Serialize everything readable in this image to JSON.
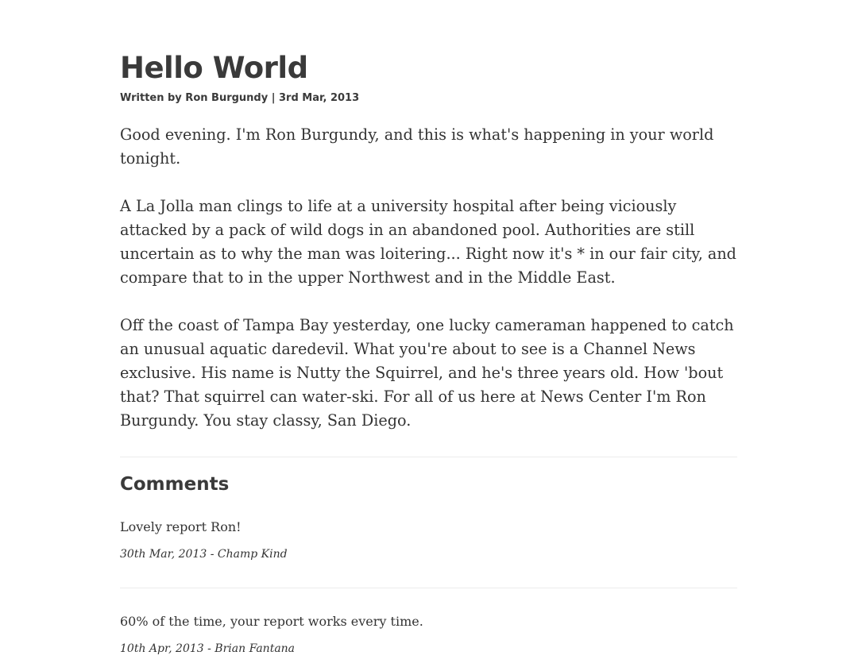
{
  "article": {
    "title": "Hello World",
    "byline": "Written by Ron Burgundy | 3rd Mar, 2013",
    "paragraphs": [
      "Good evening. I'm Ron Burgundy, and this is what's happening in your world tonight.",
      "A La Jolla man clings to life at a university hospital after being viciously attacked by a pack of wild dogs in an abandoned pool. Authorities are still uncertain as to why the man was loitering... Right now it's * in our fair city, and compare that to in the upper Northwest and in the Middle East.",
      "Off the coast of Tampa Bay yesterday, one lucky cameraman happened to catch an unusual aquatic daredevil. What you're about to see is a Channel News exclusive. His name is Nutty the Squirrel, and he's three years old. How 'bout that? That squirrel can water-ski. For all of us here at News Center I'm Ron Burgundy. You stay classy, San Diego."
    ]
  },
  "comments": {
    "heading": "Comments",
    "items": [
      {
        "text": "Lovely report Ron!",
        "meta": "30th Mar, 2013 - Champ Kind"
      },
      {
        "text": "60% of the time, your report works every time.",
        "meta": "10th Apr, 2013 - Brian Fantana"
      }
    ]
  }
}
